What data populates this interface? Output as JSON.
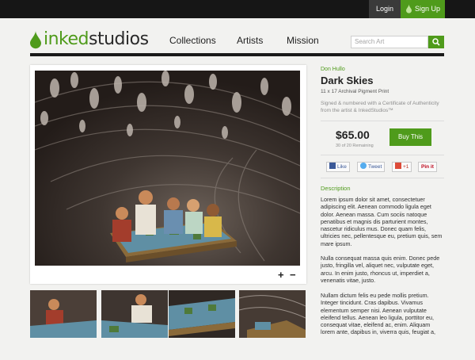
{
  "topbar": {
    "login_label": "Login",
    "signup_label": "Sign Up"
  },
  "brand": {
    "part1": "inked",
    "part2": "studios",
    "accent": "#4f9b1b"
  },
  "nav": {
    "items": [
      "Collections",
      "Artists",
      "Mission"
    ]
  },
  "search": {
    "placeholder": "Search Art"
  },
  "product": {
    "artist": "Don Hullo",
    "title": "Dark Skies",
    "print_type": "11 x 17 Archival Pigment Print",
    "certificate": "Signed & numbered with a Certificate of Authenticity from the artist & InkedStudios™",
    "price": "$65.00",
    "remaining": "30 of 20 Remaining",
    "buy_label": "Buy This",
    "zoom_in": "+",
    "zoom_out": "−"
  },
  "share": {
    "like": "Like",
    "tweet": "Tweet",
    "plusone": "+1",
    "pin": "Pin it"
  },
  "description": {
    "heading": "Description",
    "p1": "Lorem ipsum dolor sit amet, consectetuer adipiscing elit. Aenean commodo ligula eget dolor. Aenean massa. Cum sociis natoque penatibus et magnis dis parturient montes, nascetur ridiculus mus. Donec quam felis, ultricies nec, pellentesque eu, pretium quis, sem mare ipsum.",
    "p2": "Nulla consequat massa quis enim. Donec pede justo, fringilla vel, aliquet nec, vulputate eget, arcu. In enim justo, rhoncus ut, imperdiet a, venenatis vitae, justo.",
    "p3": "Nullam dictum felis eu pede mollis pretium. Integer tincidunt. Cras dapibus. Vivamus elementum semper nisi. Aenean vulputate eleifend tellus. Aenean leo ligula, porttitor eu, consequat vitae, eleifend ac, enim. Aliquam lorem ante, dapibus in, viverra quis, feugiat a,"
  }
}
